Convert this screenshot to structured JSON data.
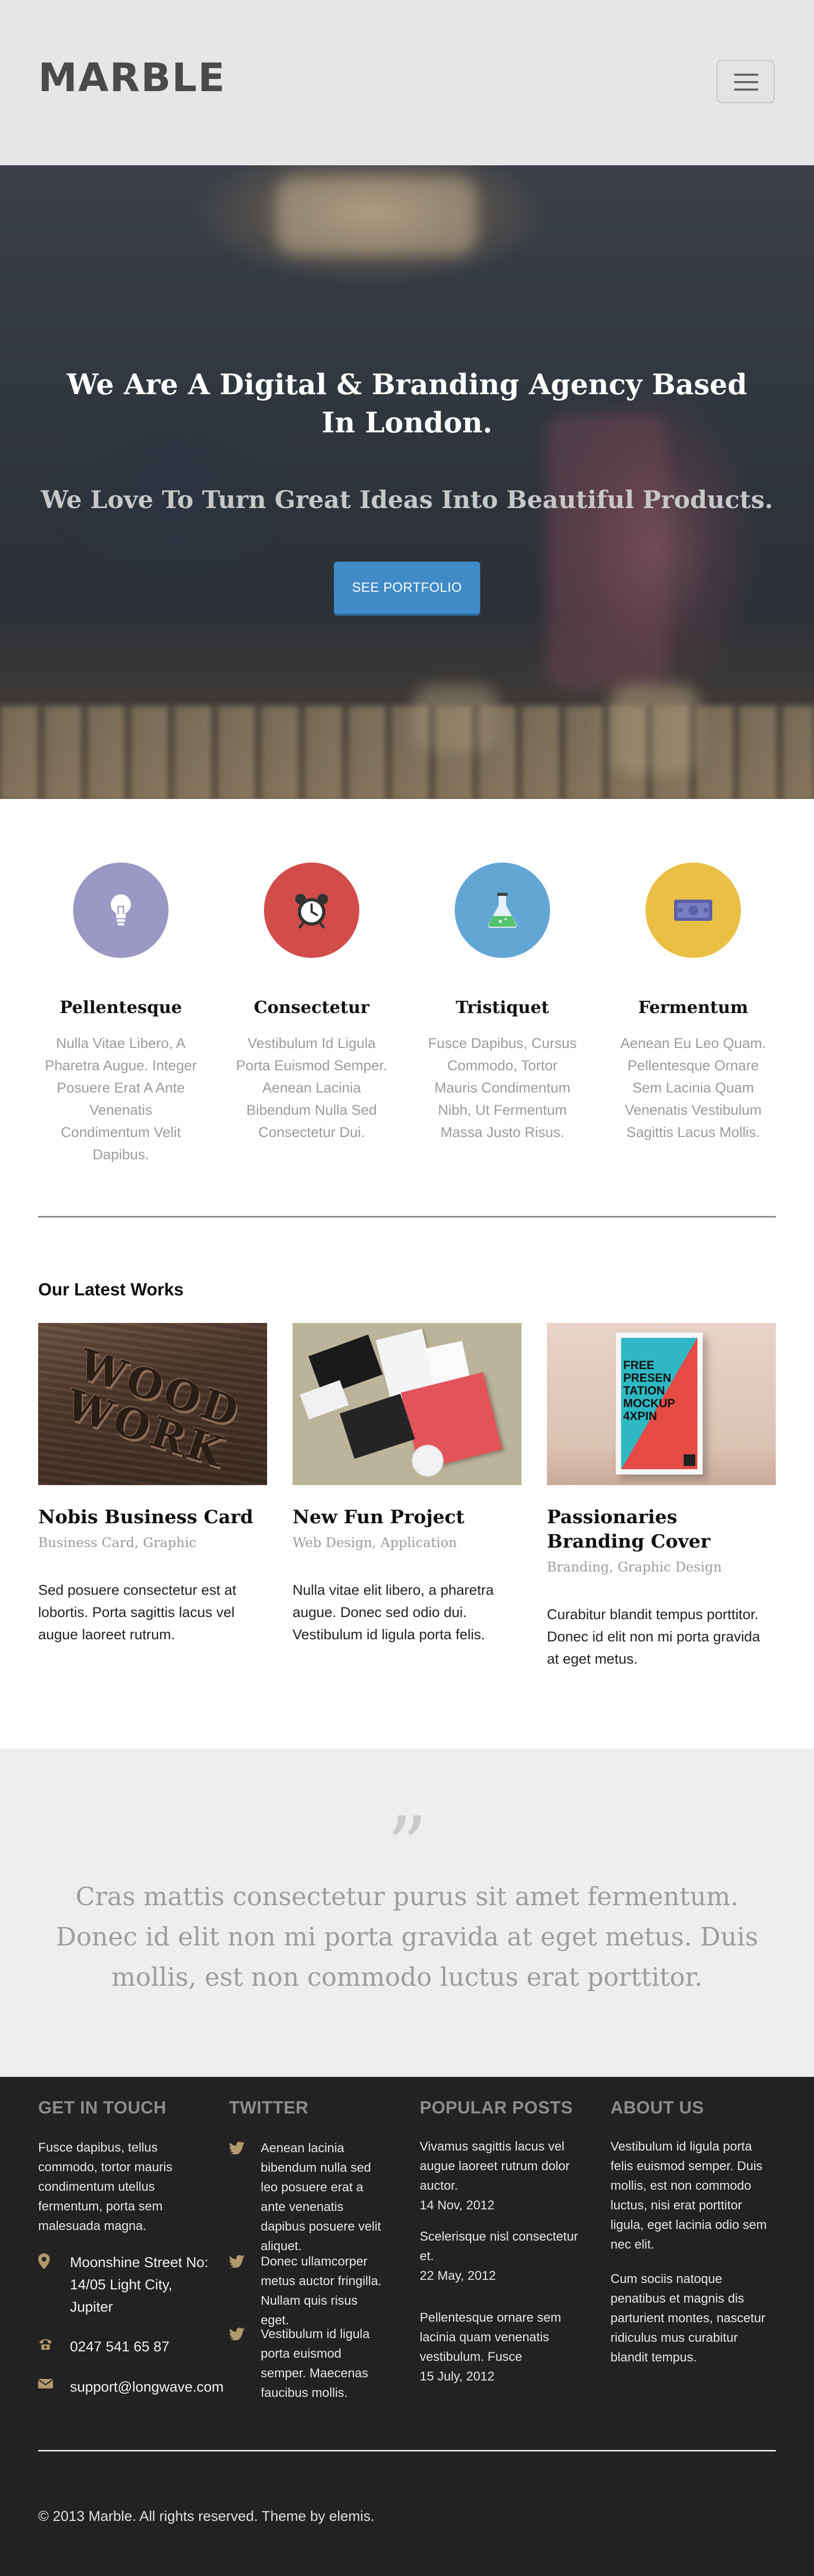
{
  "header": {
    "logo": "MARBLE",
    "menu_icon": "hamburger-icon"
  },
  "hero": {
    "headline": "We Are A Digital & Branding Agency Based In London.",
    "subheadline": "We Love To Turn Great Ideas Into Beautiful Products.",
    "cta_label": "SEE PORTFOLIO"
  },
  "features": [
    {
      "title": "Pellentesque",
      "text": "Nulla Vitae Libero, A Pharetra Augue. Integer Posuere Erat A Ante Venenatis Condimentum Velit Dapibus.",
      "icon": "lightbulb-icon",
      "color": "#9b98c4"
    },
    {
      "title": "Consectetur",
      "text": "Vestibulum Id Ligula Porta Euismod Semper. Aenean Lacinia Bibendum Nulla Sed Consectetur Dui.",
      "icon": "alarm-clock-icon",
      "color": "#d24d4a"
    },
    {
      "title": "Tristiquet",
      "text": "Fusce Dapibus, Cursus Commodo, Tortor Mauris Condimentum Nibh, Ut Fermentum Massa Justo Risus.",
      "icon": "flask-icon",
      "color": "#62a6d6"
    },
    {
      "title": "Fermentum",
      "text": "Aenean Eu Leo Quam. Pellentesque Ornare Sem Lacinia Quam Venenatis Vestibulum Sagittis Lacus Mollis.",
      "icon": "money-icon",
      "color": "#e9c043"
    }
  ],
  "works": {
    "title": "Our Latest Works",
    "items": [
      {
        "title": "Nobis Business Card",
        "category": "Business Card, Graphic",
        "description": "Sed posuere consectetur est at lobortis. Porta sagittis lacus vel augue laoreet rutrum."
      },
      {
        "title": "New Fun Project",
        "category": "Web Design, Application",
        "description": "Nulla vitae elit libero, a pharetra augue. Donec sed odio dui. Vestibulum id ligula porta felis."
      },
      {
        "title": "Passionaries Branding Cover",
        "category": "Branding, Graphic Design",
        "description": "Curabitur blandit tempus porttitor. Donec id elit non mi porta gravida at eget metus."
      }
    ],
    "thumb_text": {
      "wood_letters": "WOOD WORK",
      "poster_lines": [
        "FREE",
        "PRESEN",
        "TATION",
        "MOCKUP",
        "4XPIN"
      ]
    }
  },
  "quote": {
    "mark": "”",
    "text": "Cras mattis consectetur purus sit amet fermentum. Donec id elit non mi porta gravida at eget metus. Duis mollis, est non commodo luctus erat porttitor."
  },
  "footer": {
    "contact": {
      "title": "GET IN TOUCH",
      "text": "Fusce dapibus, tellus commodo, tortor mauris condimentum utellus fermentum, porta sem malesuada magna.",
      "address": "Moonshine Street No: 14/05 Light City, Jupiter",
      "phone": "0247 541 65 87",
      "email": "support@longwave.com"
    },
    "twitter": {
      "title": "TWITTER",
      "tweets": [
        "Aenean lacinia bibendum nulla sed leo posuere erat a ante venenatis dapibus posuere velit aliquet.",
        "Donec ullamcorper metus auctor fringilla. Nullam quis risus eget.",
        "Vestibulum id ligula porta euismod semper. Maecenas faucibus mollis."
      ]
    },
    "posts": {
      "title": "POPULAR POSTS",
      "items": [
        {
          "title": "Vivamus sagittis lacus vel augue laoreet rutrum dolor auctor.",
          "date": "14 Nov, 2012"
        },
        {
          "title": "Scelerisque nisl consectetur et.",
          "date": "22 May, 2012"
        },
        {
          "title": "Pellentesque ornare sem lacinia quam venenatis vestibulum. Fusce",
          "date": "15 July, 2012"
        }
      ]
    },
    "about": {
      "title": "ABOUT US",
      "paragraphs": [
        "Vestibulum id ligula porta felis euismod semper. Duis mollis, est non commodo luctus, nisi erat porttitor ligula, eget lacinia odio sem nec elit.",
        "Cum sociis natoque penatibus et magnis dis parturient montes, nascetur ridiculus mus curabitur blandit tempus."
      ]
    },
    "copyright": "© 2013 Marble. All rights reserved. Theme by elemis."
  },
  "colors": {
    "accent": "#3f8ac7",
    "footer_icon": "#b0996c"
  }
}
